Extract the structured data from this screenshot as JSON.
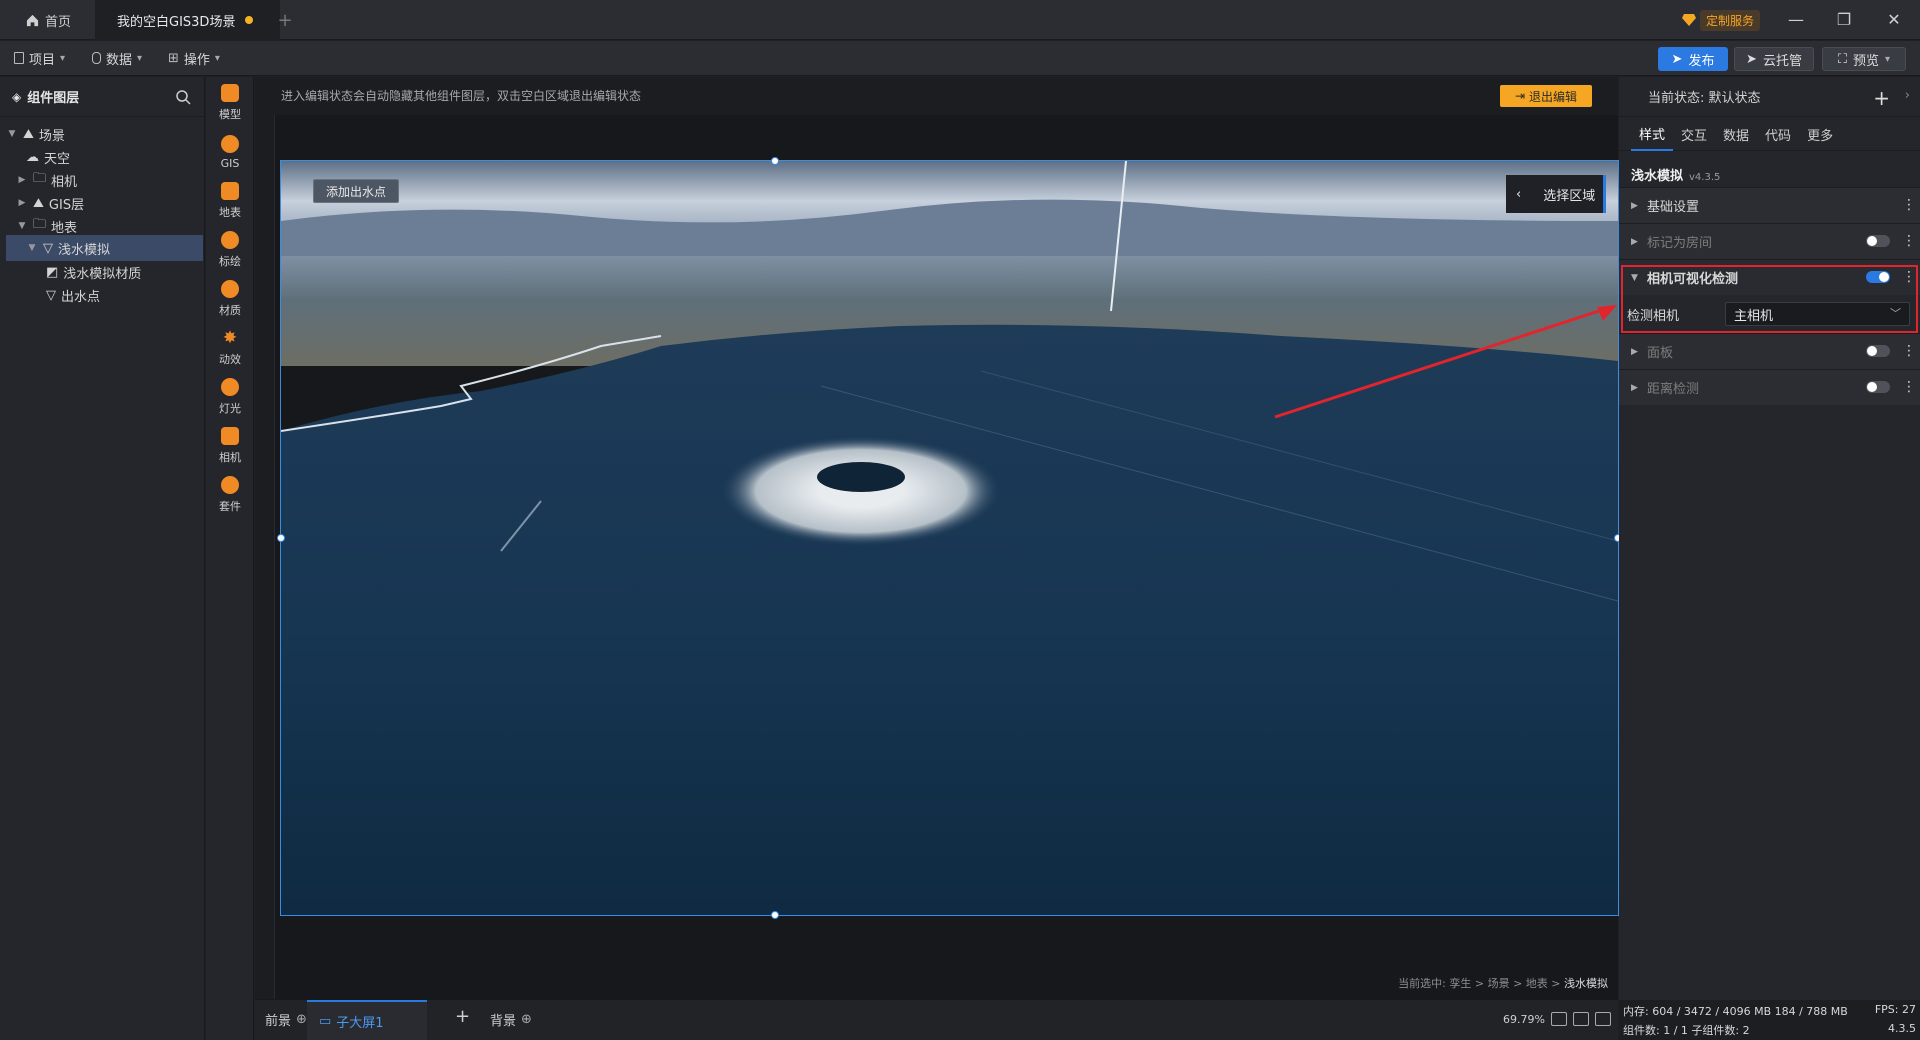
{
  "titlebar": {
    "home_tab": "首页",
    "scene_tab": "我的空白GIS3D场景",
    "add_tab": "+",
    "custom_service": "定制服务"
  },
  "toolbar": {
    "menu_project": "项目",
    "menu_data": "数据",
    "menu_operation": "操作",
    "publish": "发布",
    "cloud_hosting": "云托管",
    "preview": "预览"
  },
  "left_panel": {
    "title": "组件图层",
    "tree": [
      {
        "label": "场景"
      },
      {
        "label": "天空"
      },
      {
        "label": "相机"
      },
      {
        "label": "GIS层"
      },
      {
        "label": "地表"
      },
      {
        "label": "浅水模拟"
      },
      {
        "label": "浅水模拟材质"
      },
      {
        "label": "出水点"
      }
    ]
  },
  "icon_bar": [
    {
      "label": "模型",
      "icon": "model-icon"
    },
    {
      "label": "GIS",
      "icon": "gis-icon"
    },
    {
      "label": "地表",
      "icon": "terrain-icon"
    },
    {
      "label": "标绘",
      "icon": "marker-icon"
    },
    {
      "label": "材质",
      "icon": "material-icon"
    },
    {
      "label": "动效",
      "icon": "effect-icon"
    },
    {
      "label": "灯光",
      "icon": "light-icon"
    },
    {
      "label": "相机",
      "icon": "camera-icon"
    },
    {
      "label": "套件",
      "icon": "kit-icon"
    }
  ],
  "canvas": {
    "hint": "进入编辑状态会自动隐藏其他组件图层，双击空白区域退出编辑状态",
    "exit_edit": "退出编辑",
    "add_outlet": "添加出水点",
    "select_area": "选择区域",
    "path_prefix": "当前选中: 孪生 > 场景 > 地表 > ",
    "path_current": "浅水模拟"
  },
  "bottom_bar": {
    "foreground": "前景",
    "sub_screen": "子大屏1",
    "add": "+",
    "background": "背景",
    "zoom": "69.79%"
  },
  "right_panel": {
    "state_label": "当前状态:  默认状态",
    "tabs": [
      "样式",
      "交互",
      "数据",
      "代码",
      "更多"
    ],
    "component_name": "浅水模拟",
    "component_version": "v4.3.5",
    "sections": {
      "basic": "基础设置",
      "mark_room": "标记为房间",
      "camera_visibility": "相机可视化检测",
      "detect_camera_label": "检测相机",
      "detect_camera_value": "主相机",
      "panel": "面板",
      "distance_detect": "距离检测"
    }
  },
  "status": {
    "memory": "内存:  604 / 3472 / 4096 MB  184 / 788 MB",
    "fps": "FPS:  27",
    "counts": "组件数: 1 / 1   子组件数: 2",
    "version": "4.3.5"
  },
  "colors": {
    "accent": "#2a7ae2",
    "orange": "#f5a623",
    "highlight": "#e2252c"
  }
}
